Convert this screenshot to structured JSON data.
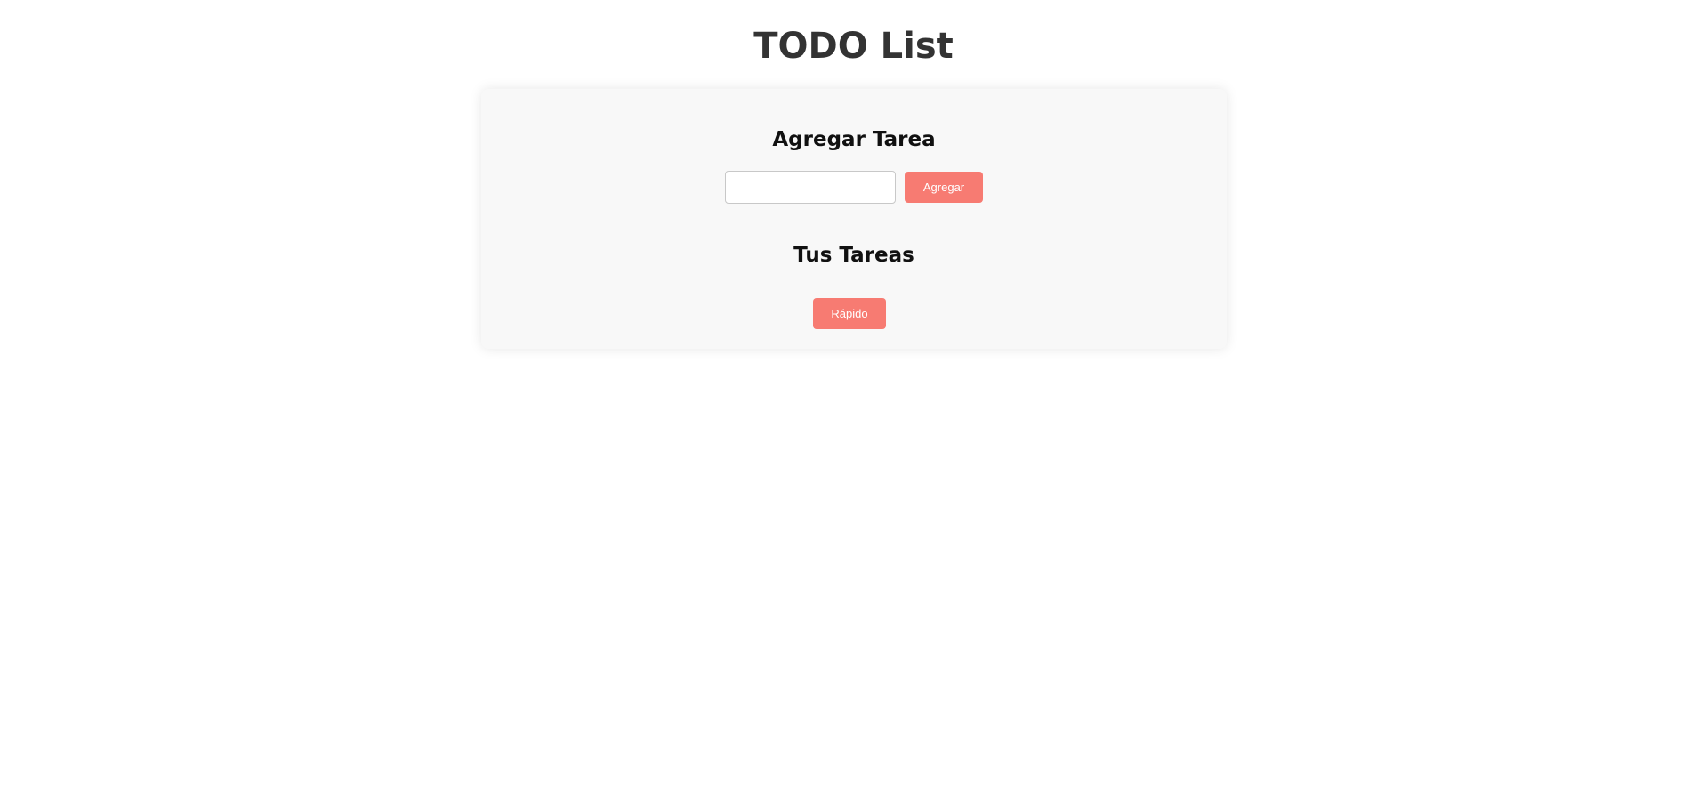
{
  "page": {
    "title": "TODO List"
  },
  "card": {
    "add_section": {
      "heading": "Agregar Tarea",
      "input_value": "",
      "input_placeholder": "",
      "add_button_label": "Agregar"
    },
    "tasks_section": {
      "heading": "Tus Tareas",
      "tasks": [],
      "quick_button_label": "Rápido"
    }
  },
  "colors": {
    "accent": "#f77b72",
    "card_background": "#f8f8f8",
    "title_text": "#333333"
  }
}
